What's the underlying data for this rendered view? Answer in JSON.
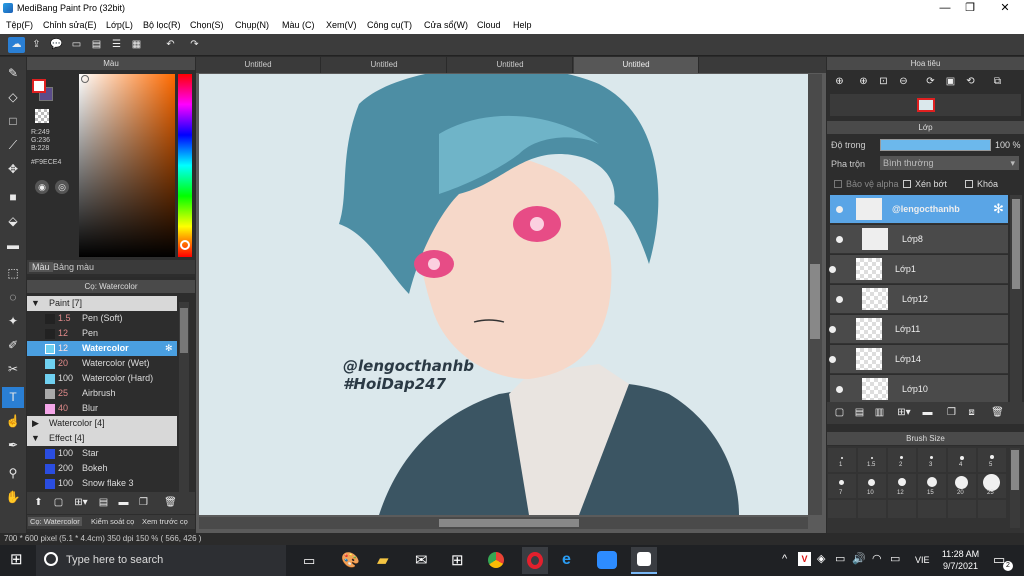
{
  "window": {
    "title": "MediBang Paint Pro (32bit)",
    "minimize": "—",
    "maximize": "❐",
    "close": "✕"
  },
  "menu": [
    "Tệp(F)",
    "Chỉnh sửa(E)",
    "Lớp(L)",
    "Bộ lọc(R)",
    "Chọn(S)",
    "Chụp(N)",
    "Màu (C)",
    "Xem(V)",
    "Công cụ(T)",
    "Cửa sổ(W)",
    "Cloud",
    "Help"
  ],
  "color_panel": {
    "title": "Màu",
    "r": "R:249",
    "g": "G:236",
    "b": "B:228",
    "hex": "#F9ECE4",
    "tab_color": "Màu",
    "tab_palette": "Bảng màu",
    "fg_color": "#F9ECE4"
  },
  "brush_panel": {
    "title": "Cọ: Watercolor",
    "groups": [
      {
        "label": "Paint [7]",
        "expanded": true,
        "items": [
          {
            "size": "1.5",
            "name": "Pen (Soft)",
            "color": "#222222"
          },
          {
            "size": "12",
            "name": "Pen",
            "color": "#222222"
          },
          {
            "size": "12",
            "name": "Watercolor",
            "color": "#6fd0f0",
            "selected": true
          },
          {
            "size": "20",
            "name": "Watercolor (Wet)",
            "color": "#6fd0f0"
          },
          {
            "size": "100",
            "name": "Watercolor (Hard)",
            "color": "#6fd0f0"
          },
          {
            "size": "25",
            "name": "Airbrush",
            "color": "#aaaaaa"
          },
          {
            "size": "40",
            "name": "Blur",
            "color": "#f4a6e8"
          }
        ]
      },
      {
        "label": "Watercolor [4]",
        "expanded": false,
        "items": []
      },
      {
        "label": "Effect [4]",
        "expanded": true,
        "items": [
          {
            "size": "100",
            "name": "Star",
            "color": "#2a4de0"
          },
          {
            "size": "200",
            "name": "Bokeh",
            "color": "#2a4de0"
          },
          {
            "size": "100",
            "name": "Snow flake 3",
            "color": "#2a4de0"
          }
        ]
      }
    ],
    "bottom_tabs": [
      "Cọ: Watercolor",
      "Kiểm soát cọ",
      "Xem trước cọ"
    ]
  },
  "canvas_tabs": [
    "Untitled",
    "Untitled",
    "Untitled",
    "Untitled"
  ],
  "canvas_text": {
    "line1": "@lengocthanhb",
    "line2": "#HoiDap247"
  },
  "navigator": {
    "title": "Hoa tiêu"
  },
  "layer_panel": {
    "title": "Lớp",
    "opacity_label": "Độ trong",
    "opacity_value": "100 %",
    "blend_label": "Pha trộn",
    "blend_value": "Bình thường",
    "protect_alpha": "Bảo vệ alpha",
    "clip": "Xén bớt",
    "lock": "Khóa",
    "layers": [
      {
        "name": "@lengocthanhb",
        "selected": true
      },
      {
        "name": "Lớp8"
      },
      {
        "name": "Lớp1"
      },
      {
        "name": "Lớp12"
      },
      {
        "name": "Lớp11"
      },
      {
        "name": "Lớp14"
      },
      {
        "name": "Lớp10"
      }
    ]
  },
  "brush_size": {
    "title": "Brush Size",
    "row1": [
      "1",
      "1.5",
      "2",
      "3",
      "4",
      "5"
    ],
    "row2": [
      "7",
      "10",
      "12",
      "15",
      "20",
      "25"
    ]
  },
  "status": "700 * 600 pixel  (5.1 * 4.4cm)  350 dpi  150 %  ( 566, 426 )",
  "taskbar": {
    "search_placeholder": "Type here to search",
    "lang": "VIE",
    "time": "11:28 AM",
    "date": "9/7/2021",
    "notif_count": "2"
  }
}
